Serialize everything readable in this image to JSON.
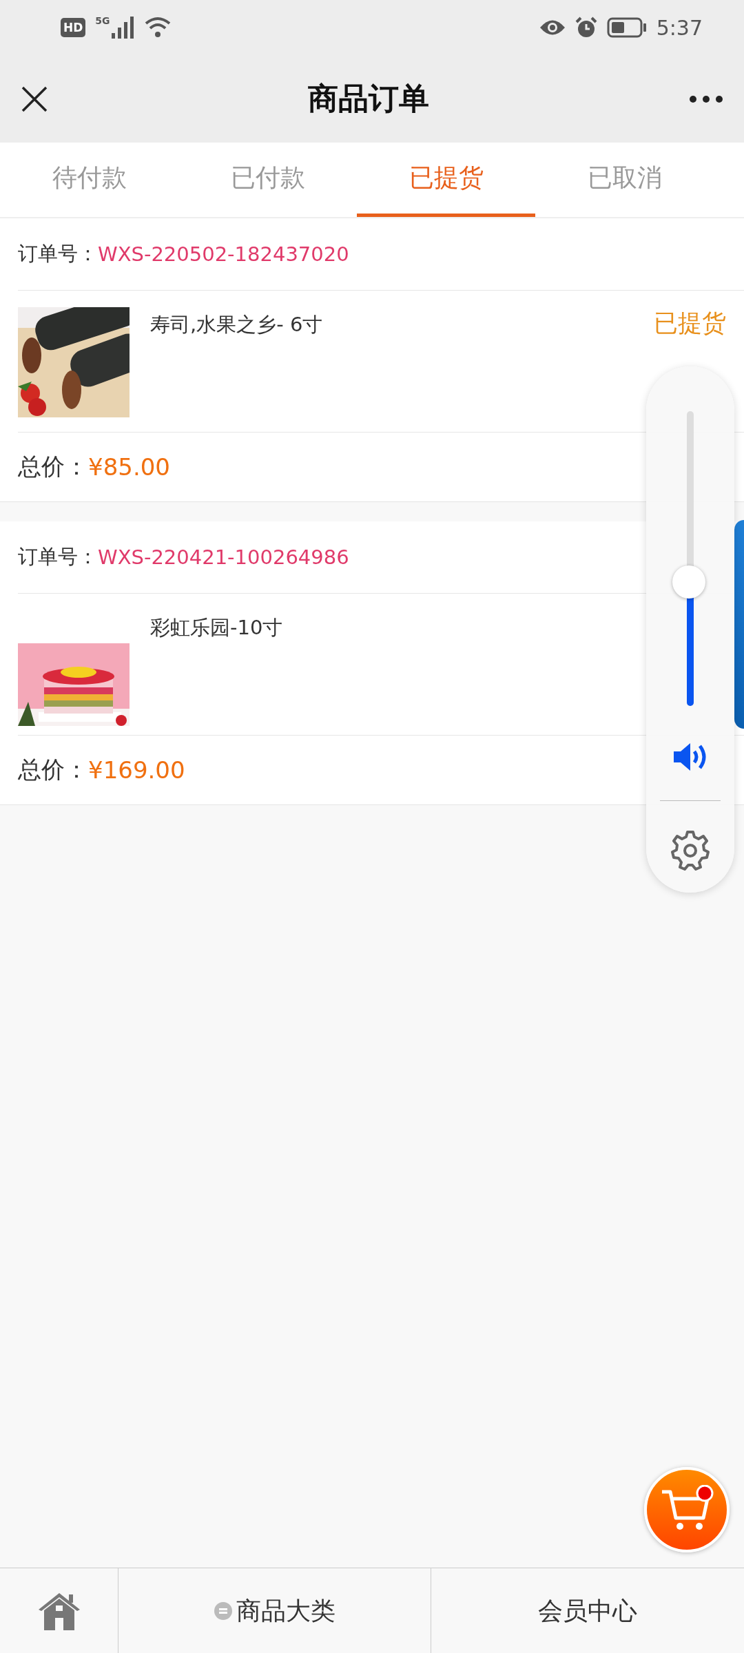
{
  "status_bar": {
    "hd": "HD",
    "network": "5G",
    "time": "5:37"
  },
  "title_bar": {
    "title": "商品订单"
  },
  "tabs": [
    {
      "label": "待付款",
      "selected": false
    },
    {
      "label": "已付款",
      "selected": false
    },
    {
      "label": "已提货",
      "selected": true
    },
    {
      "label": "已取消",
      "selected": false
    }
  ],
  "orders": [
    {
      "order_label": "订单号：",
      "order_no": "WXS-220502-182437020",
      "product": "寿司,水果之乡- 6寸",
      "status": "已提货",
      "total_label": "总价：",
      "total": "¥85.00"
    },
    {
      "order_label": "订单号：",
      "order_no": "WXS-220421-100264986",
      "product": "彩虹乐园-10寸",
      "total_label": "总价：",
      "total": "¥169.00"
    }
  ],
  "volume_panel": {
    "level": 0.42
  },
  "bottom_nav": [
    {
      "kind": "home"
    },
    {
      "kind": "menu",
      "label": "商品大类"
    },
    {
      "kind": "text",
      "label": "会员中心"
    }
  ]
}
